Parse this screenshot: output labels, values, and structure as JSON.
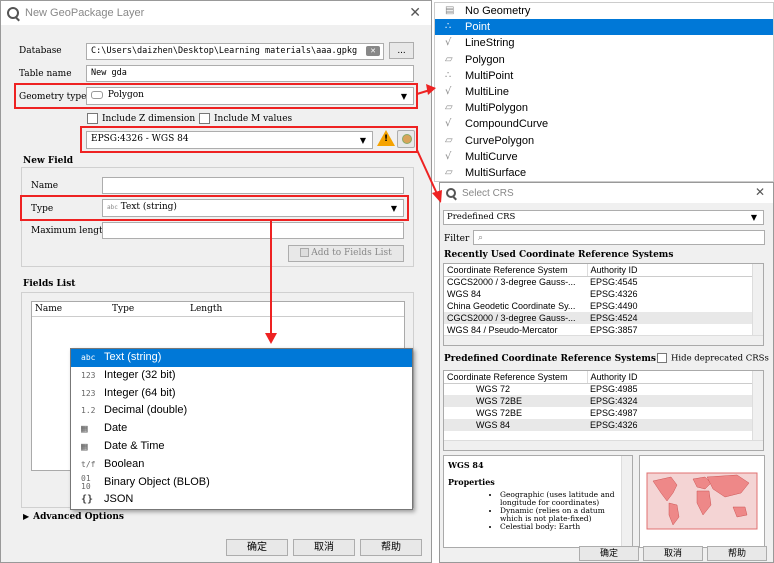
{
  "main_dialog": {
    "title": "New GeoPackage Layer",
    "database_label": "Database",
    "database_value": "C:\\Users\\daizhen\\Desktop\\Learning materials\\aaa.gpkg",
    "browse_label": "...",
    "table_name_label": "Table name",
    "table_name_value": "New gda",
    "geometry_type_label": "Geometry type",
    "geometry_type_value": "Polygon",
    "include_z_label": "Include Z dimension",
    "include_m_label": "Include M values",
    "crs_value": "EPSG:4326 - WGS 84",
    "new_field_heading": "New Field",
    "name_label": "Name",
    "type_label": "Type",
    "type_value": "Text (string)",
    "max_length_label": "Maximum length",
    "add_to_fields_label": "Add to Fields List",
    "fields_list_heading": "Fields List",
    "fields_columns": [
      "Name",
      "Type",
      "Length"
    ],
    "advanced_options_label": "Advanced Options",
    "ok_label": "确定",
    "cancel_label": "取消",
    "help_label": "帮助"
  },
  "field_type_dropdown": {
    "items": [
      {
        "icon": "abc",
        "label": "Text (string)",
        "selected": true
      },
      {
        "icon": "123",
        "label": "Integer (32 bit)"
      },
      {
        "icon": "123",
        "label": "Integer (64 bit)"
      },
      {
        "icon": "1.2",
        "label": "Decimal (double)"
      },
      {
        "icon": "calendar",
        "label": "Date"
      },
      {
        "icon": "calendar-clock",
        "label": "Date & Time"
      },
      {
        "icon": "t/f",
        "label": "Boolean"
      },
      {
        "icon": "01 10",
        "label": "Binary Object (BLOB)"
      },
      {
        "icon": "{}",
        "label": "JSON"
      }
    ]
  },
  "geometry_dropdown": {
    "items": [
      {
        "label": "No Geometry"
      },
      {
        "label": "Point",
        "selected": true
      },
      {
        "label": "LineString"
      },
      {
        "label": "Polygon"
      },
      {
        "label": "MultiPoint"
      },
      {
        "label": "MultiLine"
      },
      {
        "label": "MultiPolygon"
      },
      {
        "label": "CompoundCurve"
      },
      {
        "label": "CurvePolygon"
      },
      {
        "label": "MultiCurve"
      },
      {
        "label": "MultiSurface"
      }
    ]
  },
  "crs_dialog": {
    "title": "Select CRS",
    "predefined_combo": "Predefined CRS",
    "filter_label": "Filter",
    "recent_heading": "Recently Used Coordinate Reference Systems",
    "columns": [
      "Coordinate Reference System",
      "Authority ID"
    ],
    "recent_rows": [
      [
        "CGCS2000 / 3-degree Gauss-...",
        "EPSG:4545"
      ],
      [
        "WGS 84",
        "EPSG:4326"
      ],
      [
        "China Geodetic Coordinate Sy...",
        "EPSG:4490"
      ],
      [
        "CGCS2000 / 3-degree Gauss-...",
        "EPSG:4524"
      ],
      [
        "WGS 84 / Pseudo-Mercator",
        "EPSG:3857"
      ]
    ],
    "predefined_heading": "Predefined Coordinate Reference Systems",
    "hide_deprecated_label": "Hide deprecated CRSs",
    "predefined_rows": [
      [
        "WGS 72",
        "EPSG:4985"
      ],
      [
        "WGS 72BE",
        "EPSG:4324"
      ],
      [
        "WGS 72BE",
        "EPSG:4987"
      ],
      [
        "WGS 84",
        "EPSG:4326"
      ]
    ],
    "info_title": "WGS 84",
    "properties_heading": "Properties",
    "properties": [
      "Geographic (uses latitude and longitude for coordinates)",
      "Dynamic (relies on a datum which is not plate-fixed)",
      "Celestial body: Earth"
    ],
    "ok_label": "确定",
    "cancel_label": "取消",
    "help_label": "帮助"
  }
}
